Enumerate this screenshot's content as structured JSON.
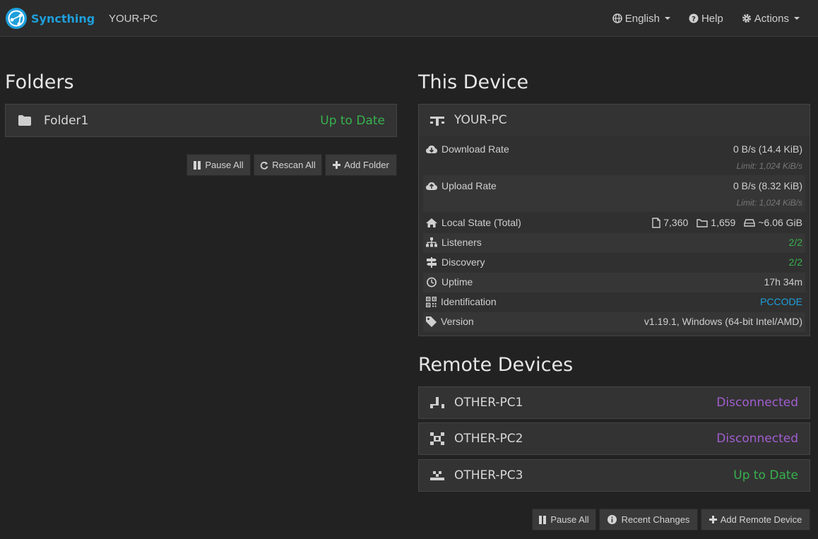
{
  "app": {
    "brand": "Syncthing",
    "device_name": "YOUR-PC"
  },
  "nav": {
    "language": "English",
    "help": "Help",
    "actions": "Actions"
  },
  "folders": {
    "heading": "Folders",
    "items": [
      {
        "name": "Folder1",
        "status": "Up to Date"
      }
    ],
    "buttons": {
      "pause_all": "Pause All",
      "rescan_all": "Rescan All",
      "add_folder": "Add Folder"
    }
  },
  "this_device": {
    "heading": "This Device",
    "name": "YOUR-PC",
    "rows": {
      "download_rate": {
        "label": "Download Rate",
        "value": "0 B/s (14.4 KiB)",
        "limit": "Limit: 1,024 KiB/s"
      },
      "upload_rate": {
        "label": "Upload Rate",
        "value": "0 B/s (8.32 KiB)",
        "limit": "Limit: 1,024 KiB/s"
      },
      "local_state": {
        "label": "Local State (Total)",
        "files": "7,360",
        "folders": "1,659",
        "size": "~6.06 GiB"
      },
      "listeners": {
        "label": "Listeners",
        "value": "2/2"
      },
      "discovery": {
        "label": "Discovery",
        "value": "2/2"
      },
      "uptime": {
        "label": "Uptime",
        "value": "17h 34m"
      },
      "identification": {
        "label": "Identification",
        "value": "PCCODE"
      },
      "version": {
        "label": "Version",
        "value": "v1.19.1, Windows (64-bit Intel/AMD)"
      }
    }
  },
  "remote_devices": {
    "heading": "Remote Devices",
    "items": [
      {
        "name": "OTHER-PC1",
        "status": "Disconnected"
      },
      {
        "name": "OTHER-PC2",
        "status": "Disconnected"
      },
      {
        "name": "OTHER-PC3",
        "status": "Up to Date"
      }
    ],
    "buttons": {
      "pause_all": "Pause All",
      "recent_changes": "Recent Changes",
      "add_remote_device": "Add Remote Device"
    }
  },
  "colors": {
    "accent": "#1e9fdc",
    "ok": "#37b24d",
    "disconnected": "#a25ed0",
    "background": "#222222"
  }
}
